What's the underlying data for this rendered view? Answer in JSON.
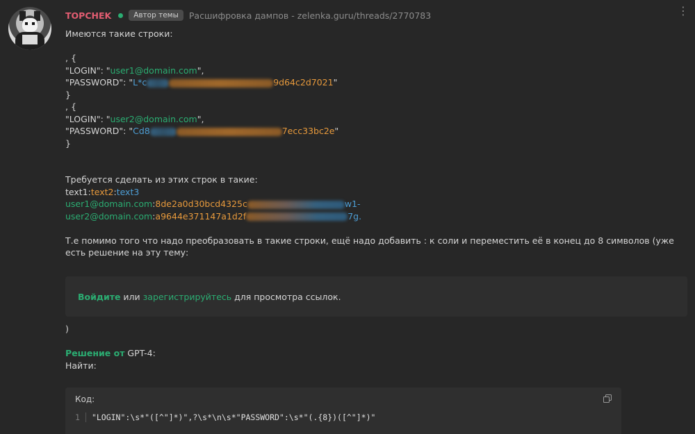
{
  "post": {
    "username": "TOPCHEK",
    "badge": "Автор темы",
    "thread_title": "Расшифровка дампов - zelenka.guru/threads/2770783",
    "menu_icon": "more-dots-icon"
  },
  "body": {
    "intro": "Имеются такие строки:",
    "block1": {
      "open": ", {",
      "login_key": "\"LOGIN\": \"",
      "login_val": "user1@domain.com",
      "login_end": "\",",
      "pass_key": "\"PASSWORD\": \"",
      "pass_start": "L*c",
      "pass_end": "9d64c2d7021",
      "pass_close": "\"",
      "close": "}"
    },
    "block2": {
      "open": ", {",
      "login_key": "\"LOGIN\": \"",
      "login_val": "user2@domain.com",
      "login_end": "\",",
      "pass_key": "\"PASSWORD\": \"",
      "pass_start": "Cd8",
      "pass_end": "7ecc33bc2e",
      "pass_close": "\"",
      "close": "}"
    },
    "required": "Требуется сделать из этих строк в такие:",
    "format": {
      "t1": "text1",
      "c1": ":",
      "t2": "text2",
      "c2": ":",
      "t3": "text3"
    },
    "out1": {
      "email": "user1@domain.com",
      "colon": ":",
      "hash_start": "8de2a0d30bcd4325c",
      "hash_end": "w1-"
    },
    "out2": {
      "email": "user2@domain.com",
      "colon": ":",
      "hash_start": "a9644e371147a1d2f",
      "hash_end": "7g."
    },
    "explanation": "Т.е помимо того что надо преобразовать в такие строки, ещё надо добавить : к соли и переместить её в конец до 8 символов (уже есть решение на эту тему:",
    "login_box": {
      "login_link": "Войдите",
      "or": " или ",
      "register_link": "зарегистрируйтесь",
      "rest": " для просмотра ссылок."
    },
    "close_paren": ")",
    "solution_label": "Решение от",
    "solution_source": " GPT-4:",
    "find": "Найти:",
    "code": {
      "title": "Код:",
      "line_no": "1",
      "text": "\"LOGIN\":\\s*\"([^\"]*)\",?\\s*\\n\\s*\"PASSWORD\":\\s*\"(.{8})([^\"]*)\"",
      "copy_icon": "copy-icon"
    }
  }
}
